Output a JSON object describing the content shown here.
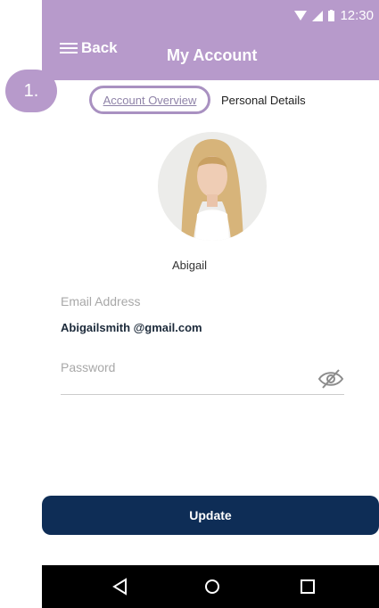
{
  "status": {
    "time": "12:30",
    "wifi_icon": "wifi-icon",
    "signal_icon": "signal-icon",
    "battery_icon": "battery-icon"
  },
  "appbar": {
    "back_label": "Back",
    "title": "My Account",
    "menu_icon": "hamburger-icon"
  },
  "annotation": {
    "step": "1."
  },
  "tabs": [
    {
      "label": "Account Overview",
      "active": true
    },
    {
      "label": "Personal Details",
      "active": false
    }
  ],
  "profile": {
    "name": "Abigail",
    "avatar": "profile-photo"
  },
  "form": {
    "email_label": "Email Address",
    "email_value": "Abigailsmith  @gmail.com",
    "password_label": "Password",
    "password_toggle_icon": "eye-off-icon"
  },
  "update_button": "Update",
  "android_nav": [
    "back-triangle-icon",
    "home-circle-icon",
    "recents-square-icon"
  ],
  "colors": {
    "accent": "#b79acb",
    "primary_button": "#0e2d56"
  }
}
